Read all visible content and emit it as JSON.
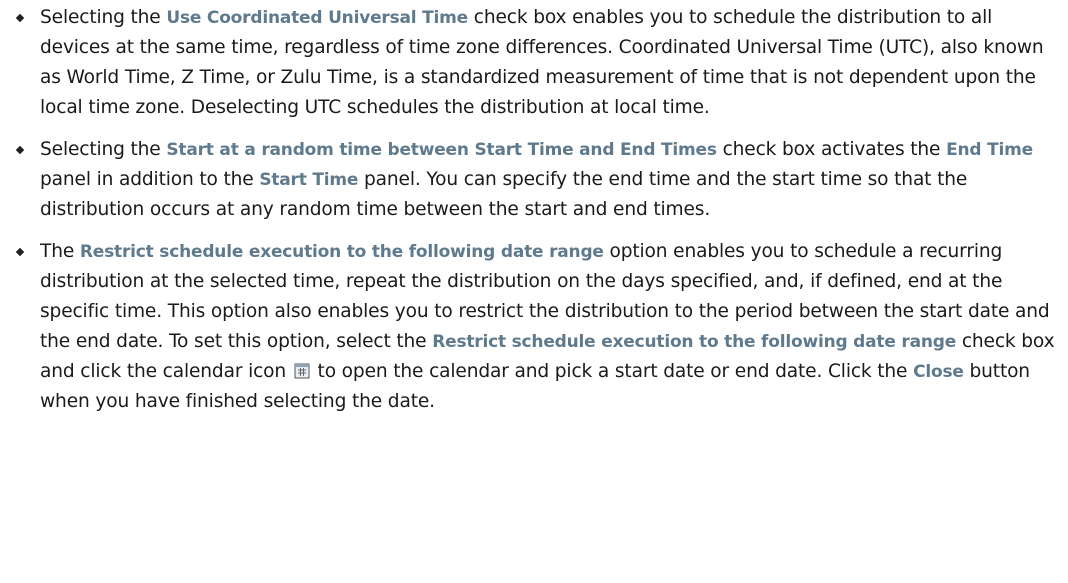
{
  "items": [
    {
      "t1": "Selecting the ",
      "b1": "Use Coordinated Universal Time",
      "t2": " check box enables you to schedule the distribution to all devices at the same time, regardless of time zone differences. Coordinated Universal Time (UTC), also known as World Time, Z Time, or Zulu Time, is a standardized measurement of time that is not dependent upon the local time zone. Deselecting UTC schedules the distribution at local time."
    },
    {
      "t1": "Selecting the ",
      "b1": "Start at a random time between Start Time and End Times",
      "t2": " check box activates the ",
      "b2": "End Time",
      "t3": " panel in addition to the ",
      "b3": "Start Time",
      "t4": " panel. You can specify the end time and the start time so that the distribution occurs at any random time between the start and end times."
    },
    {
      "t1": "The ",
      "b1": "Restrict schedule execution to the following date range",
      "t2": " option enables you to schedule a recurring distribution at the selected time, repeat the distribution on the days specified, and, if defined, end at the specific time. This option also enables you to restrict the distribution to the period between the start date and the end date. To set this option, select the ",
      "b2": "Restrict schedule execution to the following date range",
      "t3": " check box and click the calendar icon ",
      "icon": "calendar-icon",
      "t4": " to open the calendar and pick a start date or end date. Click the ",
      "b3": "Close",
      "t5": " button when you have finished selecting the date."
    }
  ]
}
